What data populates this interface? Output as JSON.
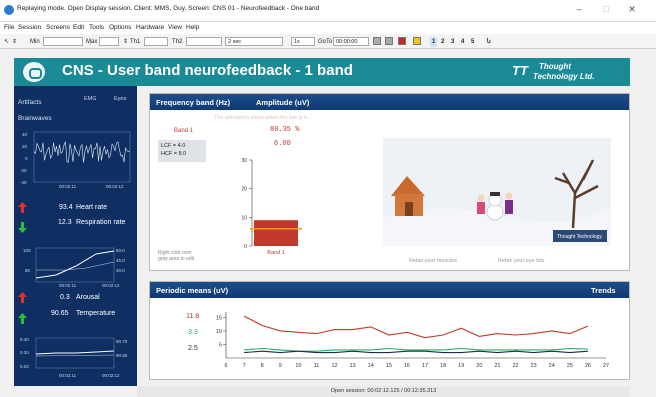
{
  "window": {
    "title": "Replaying mode. Open Display session. Client: MMS, Guy. Screen: CNS 01 - Neurofeedback - One band"
  },
  "menu": [
    "File",
    "Session",
    "Screens",
    "Edit",
    "Tools",
    "Options",
    "Hardware",
    "View",
    "Help"
  ],
  "toolbar": {
    "min_label": "Min",
    "max_label": "Max",
    "th1_label": "Th1",
    "th2_label": "Th2",
    "time_window": "2 sec",
    "speed": "1x",
    "goto_label": "GoTo",
    "goto_value": "00:00:00",
    "screens": [
      "1",
      "2",
      "3",
      "4",
      "5"
    ]
  },
  "header": {
    "title": "CNS - User band neurofeedback - 1 band",
    "brand_line1": "Thought",
    "brand_line2": "Technology Ltd.",
    "brand_mark": "TT"
  },
  "left": {
    "artifacts_label": "Artifacts",
    "emg_label": "EMG",
    "eyes_label": "Eyes",
    "brainwaves_label": "Brainwaves",
    "eeg": {
      "yticks": [
        "40",
        "20",
        "0",
        "-20",
        "-40"
      ],
      "xticks": [
        "00:02:11",
        "00:02:12"
      ]
    },
    "heart_rate": {
      "value": "93.4",
      "label": "Heart rate",
      "direction": "up",
      "color": "#e03030"
    },
    "respiration": {
      "value": "12.3",
      "label": "Respiration rate",
      "direction": "down",
      "color": "#2dbd3a"
    },
    "resp_chart": {
      "yleft": [
        "100",
        "80"
      ],
      "yright": [
        "50.0",
        "45.0",
        "40.0"
      ],
      "xticks": [
        "00:02:11",
        "00:02:12"
      ]
    },
    "arousal": {
      "value": "0.3",
      "label": "Arousal",
      "direction": "up",
      "color": "#e03030"
    },
    "temperature": {
      "value": "90.65",
      "label": "Temperature",
      "direction": "up",
      "color": "#2dbd3a"
    },
    "temp_chart": {
      "yleft": [
        "0.40",
        "0.30",
        "0.20"
      ],
      "yright": [
        "90.70",
        "90.60"
      ],
      "xticks": [
        "00:02:11",
        "00:02:12"
      ]
    }
  },
  "freq_panel": {
    "header_left": "Frequency band (Hz)",
    "header_mid": "Amplitude (uV)",
    "band_label": "Band 1",
    "lcf": "LCF = 4.0",
    "hcf": "HCF = 8.0",
    "note": "The animation starts when the bar is b...",
    "percent": "80.35 %",
    "amplitude": "6.00",
    "yticks": [
      "30",
      "20",
      "10",
      "0"
    ],
    "bar_label": "Band 1",
    "bar_value": 9,
    "threshold": 6,
    "ymax": 30,
    "right_click_hint": "Right click over gray area to edit",
    "relax_muscles": "Relax your muscles",
    "relax_eyelids": "Relax your eye lids",
    "watermark": "Thought Technology"
  },
  "periodic_panel": {
    "header_left": "Periodic means (uV)",
    "header_right": "Trends",
    "legend_values": [
      "11.8",
      "3.3",
      "2.5"
    ],
    "legend_colors": [
      "#c0392b",
      "#27ae60",
      "#1f2d4a"
    ]
  },
  "chart_data": {
    "type": "line",
    "x": [
      7,
      8,
      9,
      10,
      11,
      12,
      13,
      14,
      15,
      16,
      17,
      18,
      19,
      20,
      21,
      22,
      23,
      24,
      25,
      26
    ],
    "xticks": [
      "6",
      "7",
      "8",
      "9",
      "10",
      "11",
      "12",
      "13",
      "14",
      "15",
      "16",
      "17",
      "18",
      "19",
      "20",
      "21",
      "22",
      "23",
      "24",
      "25",
      "26",
      "27"
    ],
    "yticks": [
      "15",
      "10",
      "5"
    ],
    "ylim": [
      0,
      17
    ],
    "xlim": [
      6,
      27
    ],
    "series": [
      {
        "color": "#c0392b",
        "values": [
          15.5,
          12,
          10,
          9.5,
          9,
          10.5,
          10.5,
          11.5,
          8.5,
          9.5,
          7.5,
          8.5,
          11,
          8,
          9,
          8.5,
          9,
          10,
          9,
          11.8
        ]
      },
      {
        "color": "#27ae60",
        "values": [
          3,
          3.5,
          3,
          2.5,
          2.5,
          3,
          3,
          3,
          3.5,
          3,
          3,
          3,
          3.5,
          3,
          3,
          3,
          3,
          3,
          3.5,
          3.3
        ]
      },
      {
        "color": "#1f2d4a",
        "values": [
          2,
          2.5,
          2,
          2.5,
          2,
          2,
          2.5,
          2,
          2,
          2.5,
          2.5,
          2,
          2,
          2.5,
          2,
          2.5,
          2,
          2.5,
          2,
          2.5
        ]
      }
    ]
  },
  "status": {
    "text": "Open session: 00:02:12.125 / 00:12:35.313"
  }
}
